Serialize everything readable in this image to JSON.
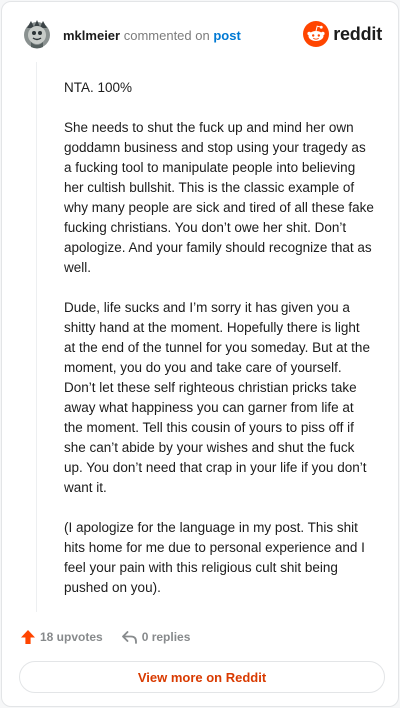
{
  "header": {
    "username": "mklmeier",
    "action_text": "commented on",
    "target_link": "post",
    "brand_name": "reddit"
  },
  "comment": {
    "paragraphs": [
      "NTA. 100%",
      "She needs to shut the fuck up and mind her own goddamn business and stop using your tragedy as a fucking tool to manipulate people into believing her cultish bullshit. This is the classic example of why many people are sick and tired of all these fake fucking christians. You don’t owe her shit. Don’t apologize. And your family should recognize that as well.",
      "Dude, life sucks and I’m sorry it has given you a shitty hand at the moment. Hopefully there is light at the end of the tunnel for you someday. But at the moment, you do you and take care of yourself. Don’t let these self righteous christian pricks take away what happiness you can garner from life at the moment. Tell this cousin of yours to piss off if she can’t abide by your wishes and shut the fuck up. You don’t need that crap in your life if you don’t want it.",
      "(I apologize for the language in my post. This shit hits home for me due to personal experience and I feel your pain with this religious cult shit being pushed on you)."
    ]
  },
  "actions": {
    "upvotes_label": "18 upvotes",
    "replies_label": "0 replies"
  },
  "footer": {
    "view_more_label": "View more on Reddit"
  },
  "colors": {
    "accent": "#ff4500",
    "link": "#0079d3",
    "view_more": "#d93a00"
  },
  "icons": [
    "avatar-icon",
    "reddit-logo-icon",
    "upvote-icon",
    "reply-icon"
  ]
}
